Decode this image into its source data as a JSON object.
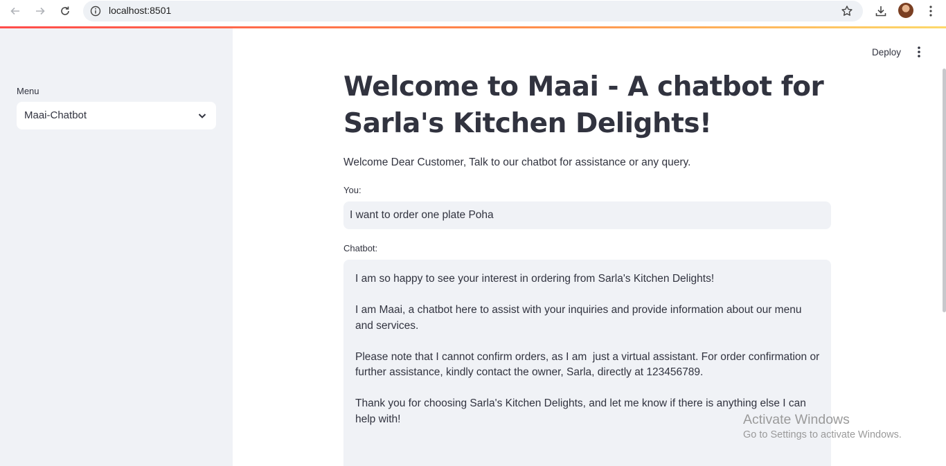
{
  "browser": {
    "url": "localhost:8501"
  },
  "sidebar": {
    "menu_label": "Menu",
    "selected": "Maai-Chatbot"
  },
  "header": {
    "deploy_label": "Deploy"
  },
  "main": {
    "title": "Welcome to Maai - A chatbot for Sarla's Kitchen Delights!",
    "subtitle": "Welcome Dear Customer, Talk to our chatbot for assistance or any query.",
    "you_label": "You:",
    "you_value": "I want to order one plate Poha",
    "chatbot_label": "Chatbot:",
    "chatbot_paragraphs": [
      "I am so happy to see your interest in ordering from Sarla's Kitchen Delights!",
      "I am Maai, a chatbot here to assist with your inquiries and provide information about our menu and services.",
      "Please note that I cannot confirm orders, as I am  just a virtual assistant. For order confirmation or further assistance, kindly contact the owner, Sarla, directly at 123456789.",
      "Thank you for choosing Sarla's Kitchen Delights, and let me know if there is anything else I can help with!"
    ]
  },
  "watermark": {
    "title": "Activate Windows",
    "subtitle": "Go to Settings to activate Windows."
  },
  "colors": {
    "accent": "#ff4b4b",
    "sidebar_bg": "#f0f2f6",
    "text": "#31333f"
  }
}
